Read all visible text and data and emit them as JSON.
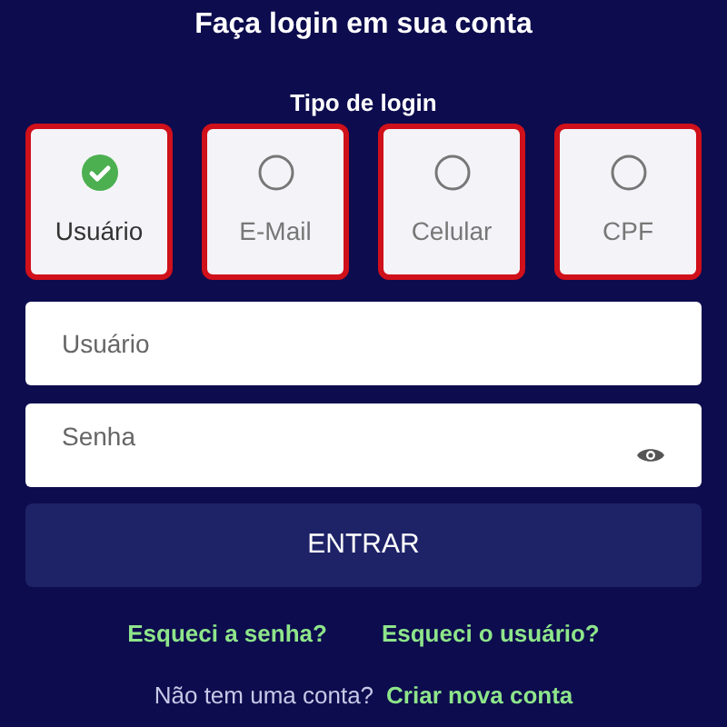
{
  "title": "Faça login em sua conta",
  "login_type": {
    "label": "Tipo de login",
    "options": [
      {
        "label": "Usuário",
        "selected": true
      },
      {
        "label": "E-Mail",
        "selected": false
      },
      {
        "label": "Celular",
        "selected": false
      },
      {
        "label": "CPF",
        "selected": false
      }
    ]
  },
  "fields": [
    {
      "placeholder": "Usuário",
      "kind": "text"
    },
    {
      "placeholder": "Senha",
      "kind": "password"
    }
  ],
  "submit": "ENTRAR",
  "links": [
    "Esqueci a senha?",
    "Esqueci o usuário?"
  ],
  "signup": {
    "prompt": "Não tem uma conta?",
    "link": "Criar nova conta"
  }
}
